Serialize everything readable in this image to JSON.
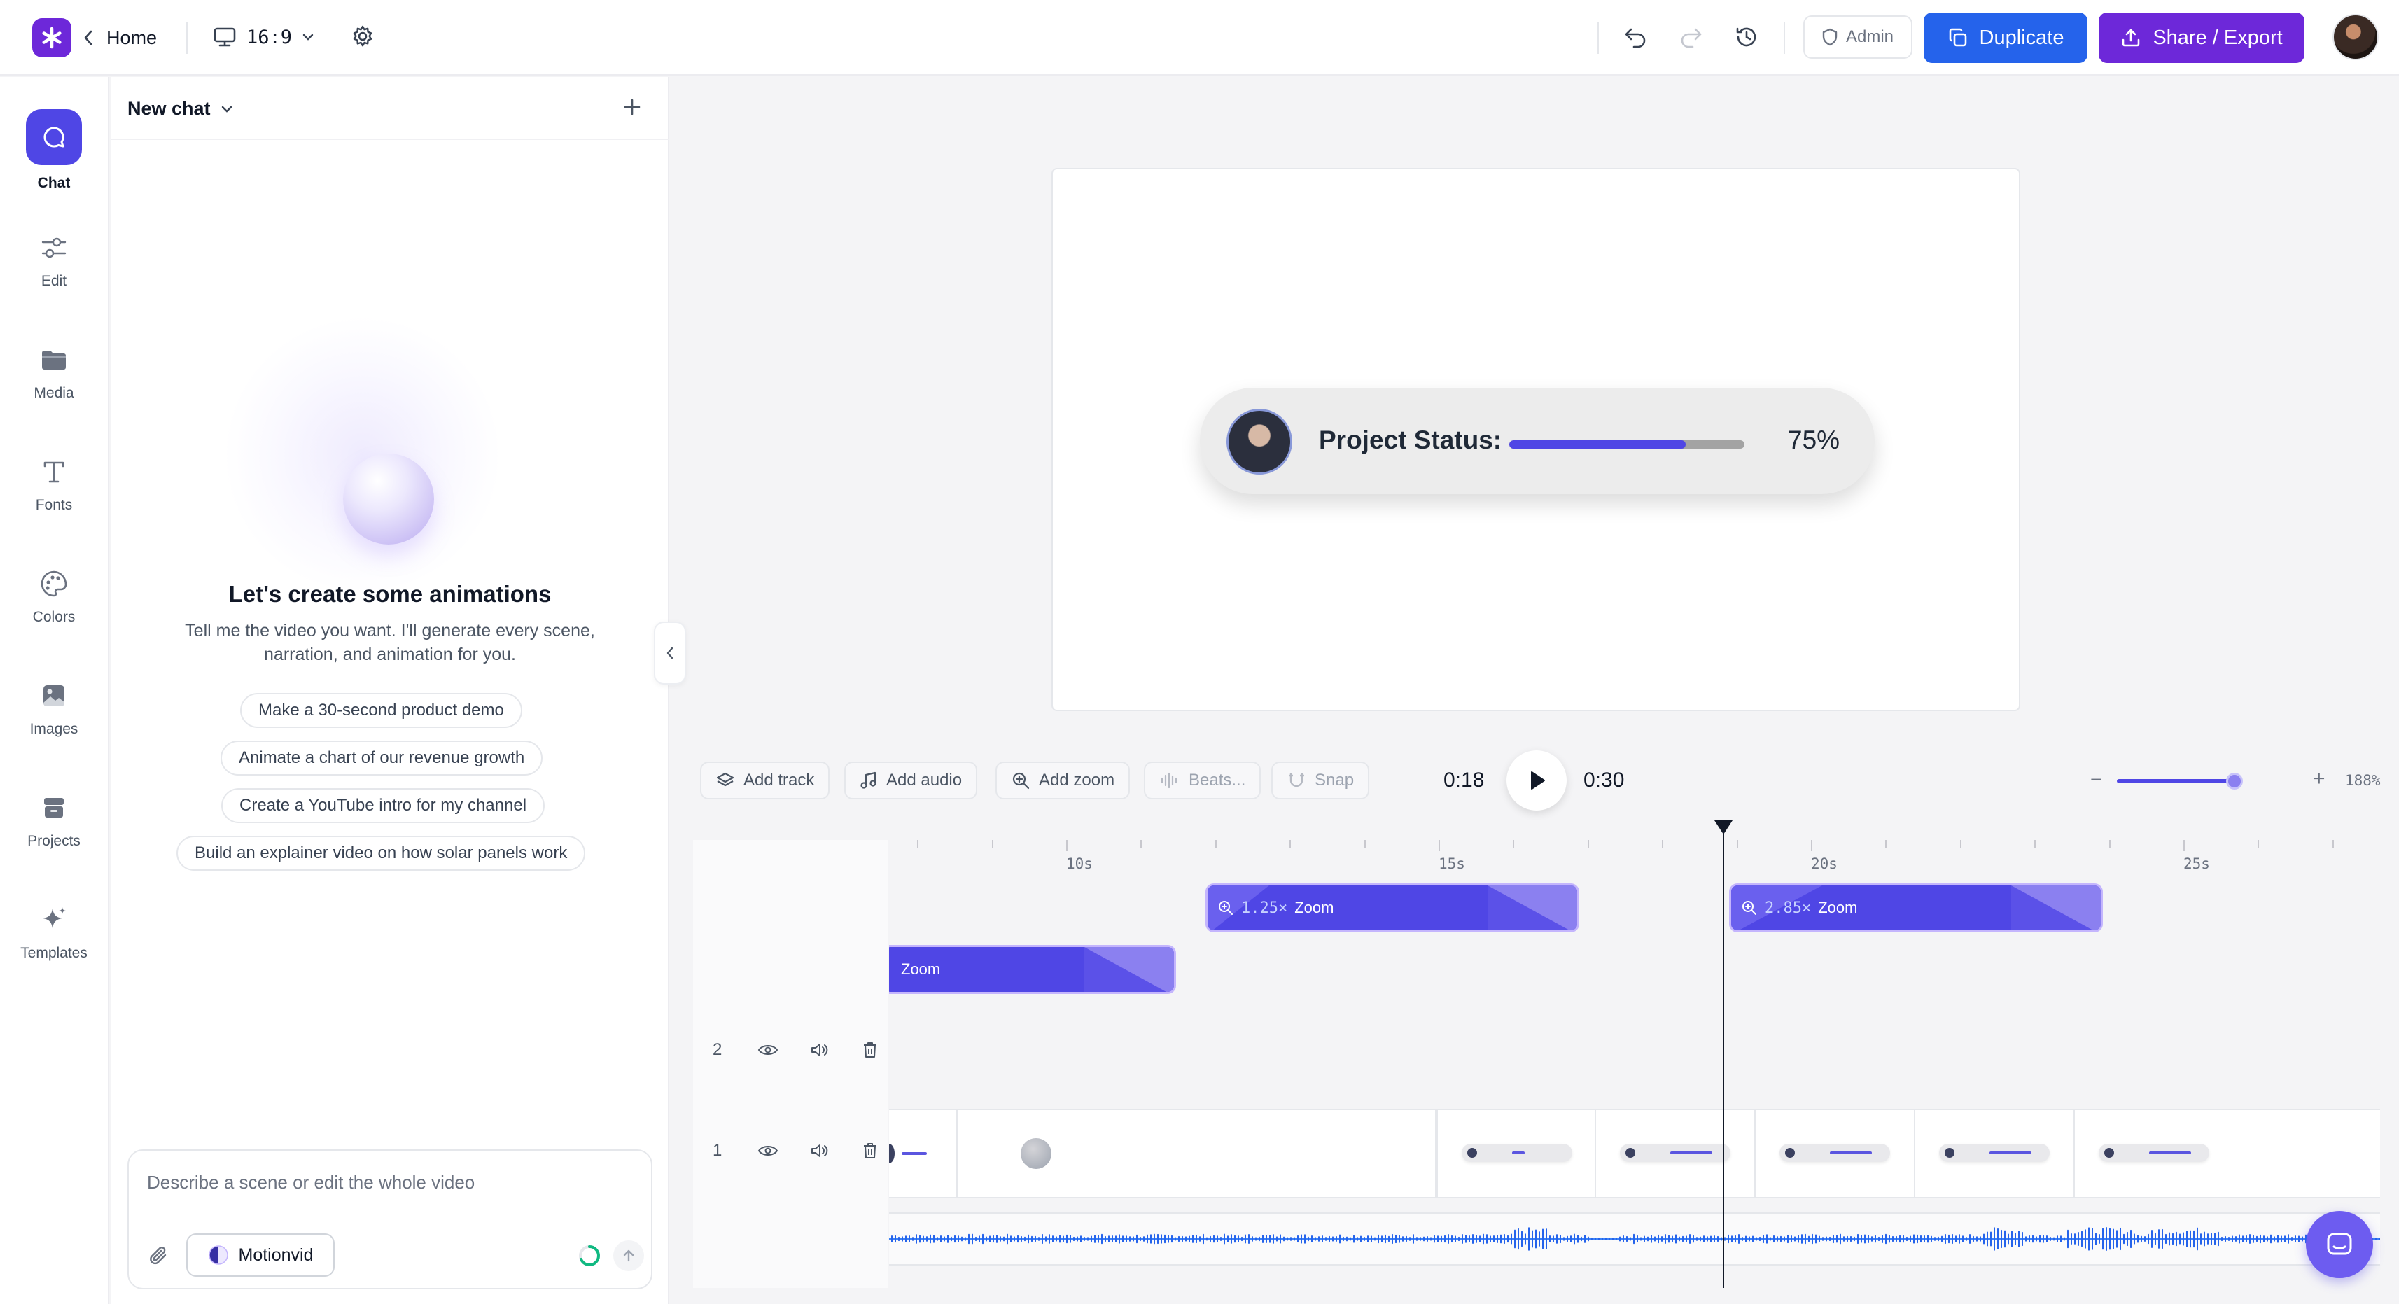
{
  "topbar": {
    "home_label": "Home",
    "aspect_label": "16:9",
    "admin_label": "Admin",
    "duplicate_label": "Duplicate",
    "share_label": "Share / Export"
  },
  "rail": {
    "items": [
      {
        "label": "Chat",
        "icon": "chat-icon"
      },
      {
        "label": "Edit",
        "icon": "sliders-icon"
      },
      {
        "label": "Media",
        "icon": "folder-icon"
      },
      {
        "label": "Fonts",
        "icon": "type-icon"
      },
      {
        "label": "Colors",
        "icon": "palette-icon"
      },
      {
        "label": "Images",
        "icon": "image-icon"
      },
      {
        "label": "Projects",
        "icon": "archive-icon"
      },
      {
        "label": "Templates",
        "icon": "sparkle-icon"
      }
    ]
  },
  "chat": {
    "title": "New chat",
    "hero_title": "Let's create some animations",
    "hero_subtitle": "Tell me the video you want. I'll generate every scene, narration, and animation for you.",
    "suggestions": [
      "Make a 30-second product demo",
      "Animate a chart of our revenue growth",
      "Create a YouTube intro for my channel",
      "Build an explainer video on how solar panels work"
    ],
    "composer_placeholder": "Describe a scene or edit the whole video",
    "model_label": "Motionvid"
  },
  "preview": {
    "status_label": "Project Status:",
    "status_percent_text": "75%",
    "progress_fraction": 0.75
  },
  "timeline": {
    "toolbar": {
      "add_track": "Add track",
      "add_audio": "Add audio",
      "add_zoom": "Add zoom",
      "beats": "Beats...",
      "snap": "Snap"
    },
    "current_time": "0:18",
    "total_time": "0:30",
    "zoom_percent": "188%",
    "ruler_labels": [
      "10s",
      "15s",
      "20s",
      "25s"
    ],
    "zoom_clips": [
      {
        "label": "Zoom"
      },
      {
        "multiplier": "1.25×",
        "label": "Zoom"
      },
      {
        "multiplier": "2.85×",
        "label": "Zoom"
      }
    ],
    "tracks": [
      {
        "number": "2"
      },
      {
        "number": "1"
      }
    ],
    "accent_color": "#4f46e5"
  }
}
